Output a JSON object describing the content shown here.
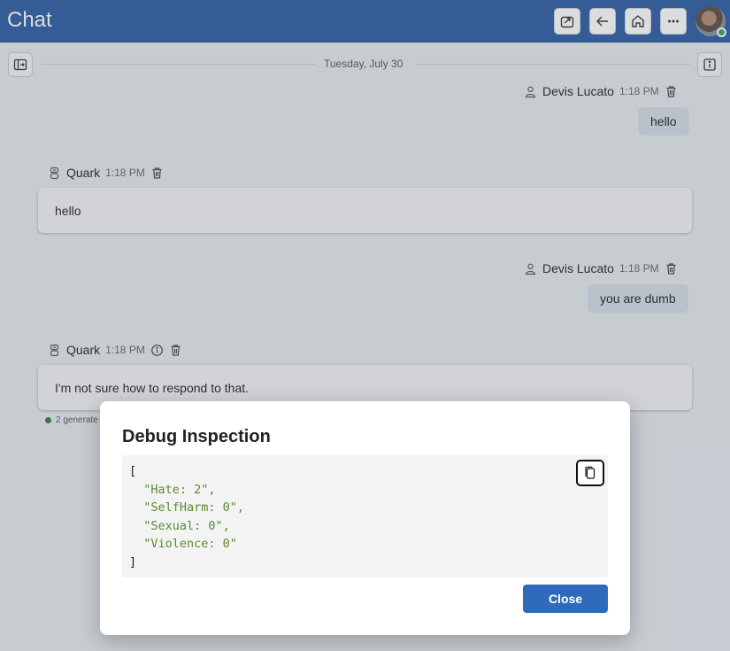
{
  "header": {
    "title": "Chat",
    "buttons": [
      "share-icon",
      "back-arrow-icon",
      "home-icon",
      "more-icon"
    ]
  },
  "chat": {
    "date_divider": "Tuesday, July 30",
    "messages": [
      {
        "role": "user",
        "sender": "Devis Lucato",
        "time": "1:18 PM",
        "text": "hello"
      },
      {
        "role": "bot",
        "sender": "Quark",
        "time": "1:18 PM",
        "text": "hello"
      },
      {
        "role": "user",
        "sender": "Devis Lucato",
        "time": "1:18 PM",
        "text": "you are dumb"
      },
      {
        "role": "bot",
        "sender": "Quark",
        "time": "1:18 PM",
        "text": "I'm not sure how to respond to that."
      }
    ],
    "generation_note": "2 generate"
  },
  "modal": {
    "title": "Debug Inspection",
    "code_lines": [
      "[",
      "  \"Hate: 2\",",
      "  \"SelfHarm: 0\",",
      "  \"Sexual: 0\",",
      "  \"Violence: 0\"",
      "]"
    ],
    "close_label": "Close"
  },
  "colors": {
    "header_bg": "#2b5aa0",
    "primary_button": "#2f6bbd",
    "user_bubble": "#d4dbe6",
    "code_string": "#5b8a2f"
  }
}
